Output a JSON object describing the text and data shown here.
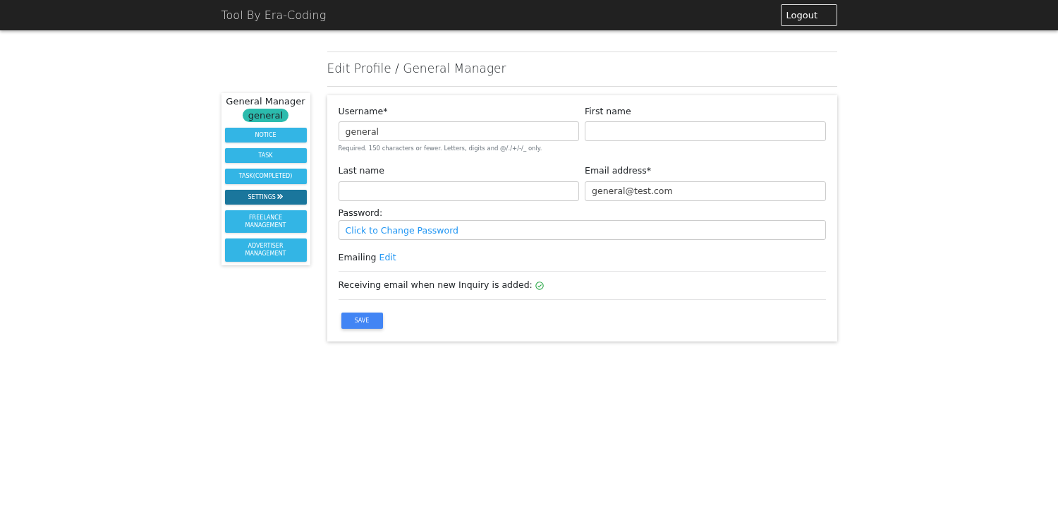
{
  "navbar": {
    "brand": "Tool By Era-Coding",
    "logout": "Logout"
  },
  "page_title": "Edit Profile / General Manager",
  "profile": {
    "role": "General Manager",
    "badge": "general"
  },
  "menu": [
    {
      "label": "NOTICE",
      "selected": false
    },
    {
      "label": "TASK",
      "selected": false
    },
    {
      "label": "TASK(COMPLETED)",
      "selected": false
    },
    {
      "label": "SETTINGS",
      "selected": true
    },
    {
      "label": "FREELANCE MANAGEMENT",
      "selected": false
    },
    {
      "label": "ADVERTISER MANAGEMENT",
      "selected": false
    }
  ],
  "fields": [
    {
      "label": "Username*",
      "value": "general",
      "help": "Required. 150 characters or fewer. Letters, digits and @/./+/-/_ only."
    },
    {
      "label": "First name"
    },
    {
      "label": "Last name"
    },
    {
      "label": "Email address*",
      "value": "general@test.com"
    }
  ],
  "password": {
    "label": "Password:",
    "link": "Click to Change Password"
  },
  "emailing": {
    "label": "Emailing",
    "link": "Edit"
  },
  "notification": {
    "text": "Receiving email when new Inquiry is added:",
    "enabled": true
  },
  "save": "SAVE"
}
